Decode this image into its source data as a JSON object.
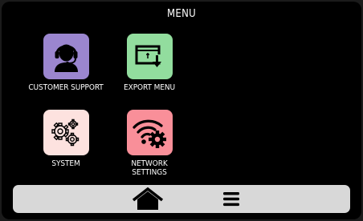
{
  "header": {
    "title": "MENU"
  },
  "menu_items": [
    {
      "label": "CUSTOMER SUPPORT",
      "icon": "headset-icon",
      "color": "#9b86cf"
    },
    {
      "label": "EXPORT MENU",
      "icon": "export-icon",
      "color": "#92dd9e"
    },
    {
      "label": "SYSTEM",
      "icon": "gears-icon",
      "color": "#fde2df"
    },
    {
      "label": "NETWORK\nSETTINGS",
      "icon": "wifi-gear-icon",
      "color": "#f98f99"
    }
  ],
  "nav": {
    "home_icon": "home-icon",
    "menu_icon": "hamburger-icon",
    "bar_color": "#d8d8d8"
  }
}
